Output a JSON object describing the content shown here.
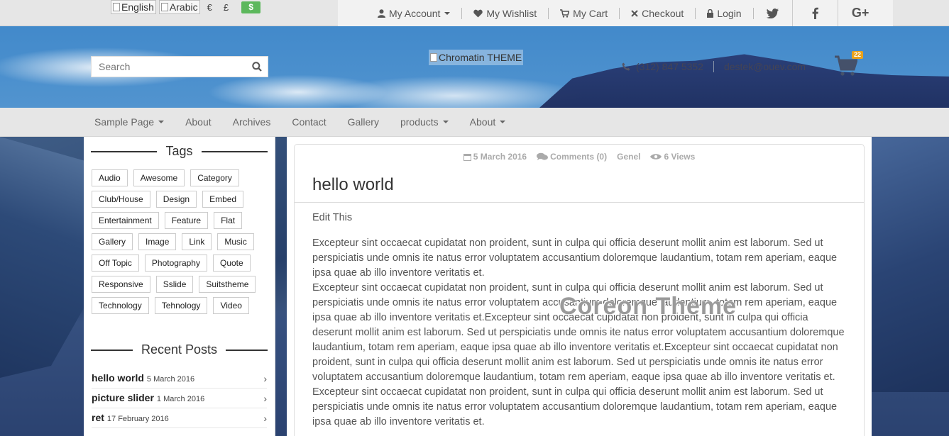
{
  "topbar": {
    "languages": [
      {
        "label": "English"
      },
      {
        "label": "Arabic"
      }
    ],
    "currencies": [
      "€",
      "£",
      "$"
    ],
    "account_nav": [
      {
        "label": "My Account",
        "icon": "user-icon",
        "dropdown": true
      },
      {
        "label": "My Wishlist",
        "icon": "heart-icon"
      },
      {
        "label": "My Cart",
        "icon": "cart-icon"
      },
      {
        "label": "Checkout",
        "icon": "close-icon"
      },
      {
        "label": "Login",
        "icon": "lock-icon"
      }
    ],
    "social": [
      "twitter-icon",
      "facebook-icon",
      "google-plus-icon"
    ]
  },
  "header": {
    "search_placeholder": "Search",
    "logo_alt": "Chromatin THEME",
    "phone": "(312) 847 5352",
    "email": "destek@ouev.com",
    "cart_count": "22"
  },
  "nav": {
    "items": [
      {
        "label": "Sample Page",
        "dropdown": true
      },
      {
        "label": "About",
        "dropdown": false
      },
      {
        "label": "Archives",
        "dropdown": false
      },
      {
        "label": "Contact",
        "dropdown": false
      },
      {
        "label": "Gallery",
        "dropdown": false
      },
      {
        "label": "products",
        "dropdown": true
      },
      {
        "label": "About",
        "dropdown": true
      }
    ]
  },
  "sidebar": {
    "tags_title": "Tags",
    "tags": [
      "Audio",
      "Awesome",
      "Category",
      "Club/House",
      "Design",
      "Embed",
      "Entertainment",
      "Feature",
      "Flat",
      "Gallery",
      "Image",
      "Link",
      "Music",
      "Off Topic",
      "Photography",
      "Quote",
      "Responsive",
      "Sslide",
      "Suitstheme",
      "Technology",
      "Tehnology",
      "Video"
    ],
    "recent_title": "Recent Posts",
    "recent_posts": [
      {
        "title": "hello world",
        "date": "5 March 2016"
      },
      {
        "title": "picture slider",
        "date": "1 March 2016"
      },
      {
        "title": "ret",
        "date": "17 February 2016"
      }
    ]
  },
  "post": {
    "date": "5 March 2016",
    "comments": "Comments (0)",
    "category": "Genel",
    "views": "6 Views",
    "title": "hello world",
    "edit_label": "Edit This",
    "paragraphs": [
      "Excepteur sint occaecat cupidatat non proident, sunt in culpa qui officia deserunt mollit anim est laborum. Sed ut perspiciatis unde omnis ite natus error voluptatem accusantium doloremque laudantium, totam rem aperiam, eaque ipsa quae ab illo inventore veritatis et.",
      "Excepteur sint occaecat cupidatat non proident, sunt in culpa qui officia deserunt mollit anim est laborum. Sed ut perspiciatis unde omnis ite natus error voluptatem accusantium doloremque laudantium, totam rem aperiam, eaque ipsa quae ab illo inventore veritatis et.Excepteur sint occaecat cupidatat non proident, sunt in culpa qui officia deserunt mollit anim est laborum. Sed ut perspiciatis unde omnis ite natus error voluptatem accusantium doloremque laudantium, totam rem aperiam, eaque ipsa quae ab illo inventore veritatis et.Excepteur sint occaecat cupidatat non proident, sunt in culpa qui officia deserunt mollit anim est laborum. Sed ut perspiciatis unde omnis ite natus error voluptatem accusantium doloremque laudantium, totam rem aperiam, eaque ipsa quae ab illo inventore veritatis et.",
      "Excepteur sint occaecat cupidatat non proident, sunt in culpa qui officia deserunt mollit anim est laborum. Sed ut perspiciatis unde omnis ite natus error voluptatem accusantium doloremque laudantium, totam rem aperiam, eaque ipsa quae ab illo inventore veritatis et."
    ],
    "watermark": "Coreon Theme"
  },
  "colors": {
    "currency_active": "#5cb85c",
    "cart_badge": "#e9a21b"
  }
}
